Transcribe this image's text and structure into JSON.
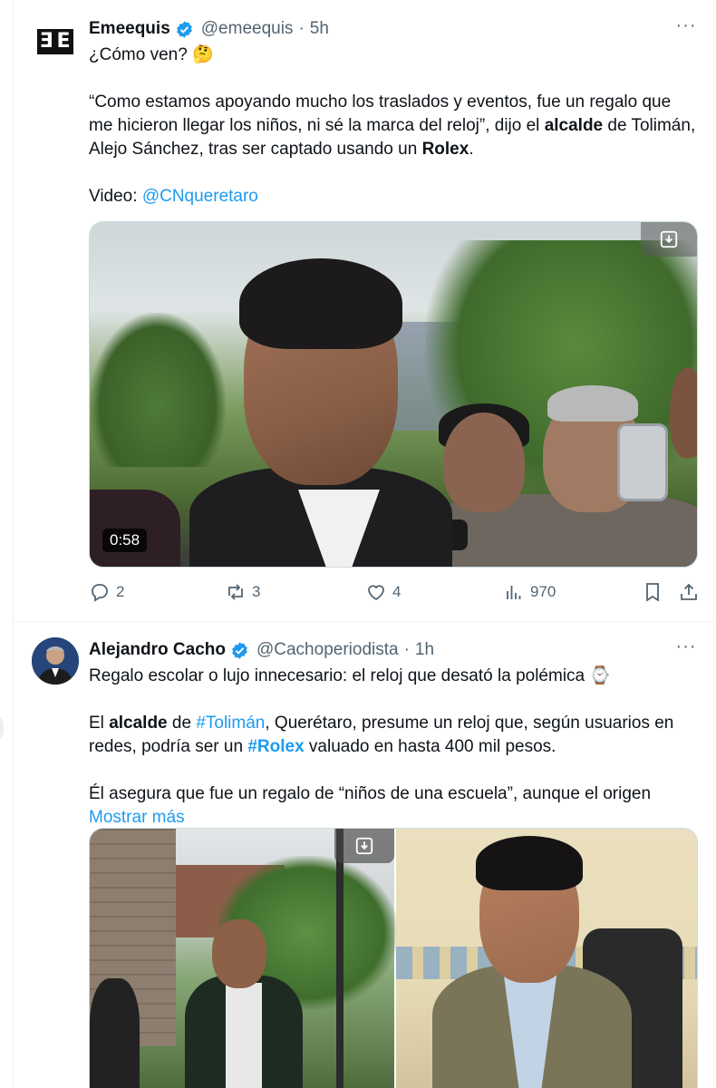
{
  "tweets": [
    {
      "name": "Emeequis",
      "handle": "@emeequis",
      "time": "5h",
      "text": {
        "line1": "¿Cómo ven? 🤔",
        "quote_a": "“Como estamos apoyando mucho los traslados y eventos, fue un regalo que me hicieron llegar los niños, ni sé la marca del reloj”, dijo el ",
        "bold_1": "alcalde",
        "quote_b": " de Tolimán, Alejo Sánchez, tras ser captado usando un ",
        "bold_2": "Rolex",
        "quote_c": ".",
        "video_label": "Video: ",
        "video_link": "@CNqueretaro"
      },
      "media": {
        "duration": "0:58"
      },
      "actions": {
        "replies": "2",
        "reposts": "3",
        "likes": "4",
        "views": "970"
      }
    },
    {
      "name": "Alejandro Cacho",
      "handle": "@Cachoperiodista",
      "time": "1h",
      "text": {
        "line1": "Regalo escolar o lujo innecesario: el reloj que desató la polémica ⌚",
        "p2_a": "El ",
        "p2_bold": "alcalde",
        "p2_b": " de ",
        "p2_tag1": "#Tolimán",
        "p2_c": ", Querétaro, presume un reloj que, según usuarios en redes, podría ser un ",
        "p2_tag2": "#Rolex",
        "p2_d": " valuado en hasta 400 mil pesos.",
        "p3": "Él asegura que fue un regalo de “niños de una escuela”, aunque el origen",
        "show_more": "Mostrar más"
      }
    }
  ],
  "colors": {
    "link": "#1d9bf0",
    "verified": "#1d9bf0",
    "muted": "#536471",
    "text": "#0f1419"
  },
  "icons": [
    "more-icon",
    "verified-icon",
    "download-icon",
    "reply-icon",
    "repost-icon",
    "like-icon",
    "views-icon",
    "bookmark-icon",
    "share-icon"
  ]
}
